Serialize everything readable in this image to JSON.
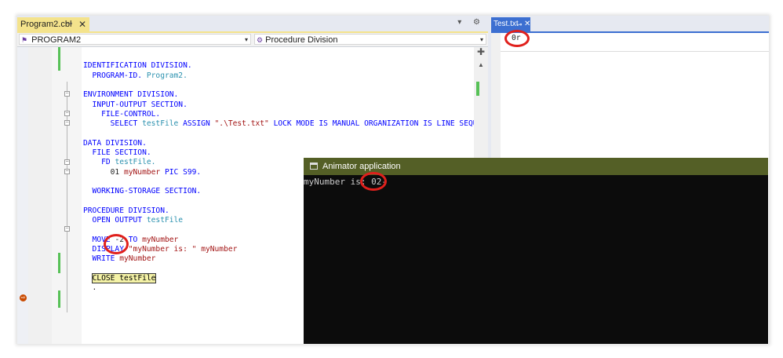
{
  "editor": {
    "tab_label": "Program2.cbl",
    "pin_glyph": "⊸",
    "close_glyph": "✕",
    "strip_icons": "▾ ⚙",
    "nav_left": "PROGRAM2",
    "nav_right": "Procedure Division",
    "dropdown_glyph": "▾",
    "breakpoint_glyph": "⇨"
  },
  "code_lines": [
    [],
    [
      {
        "t": "IDENTIFICATION DIVISION.",
        "c": "kw"
      }
    ],
    [
      {
        "t": "  PROGRAM-ID. ",
        "c": "kw"
      },
      {
        "t": "Program2.",
        "c": "id"
      }
    ],
    [],
    [
      {
        "t": "ENVIRONMENT DIVISION.",
        "c": "kw"
      }
    ],
    [
      {
        "t": "  INPUT-OUTPUT SECTION.",
        "c": "kw"
      }
    ],
    [
      {
        "t": "    FILE-CONTROL.",
        "c": "kw"
      }
    ],
    [
      {
        "t": "      SELECT ",
        "c": "kw"
      },
      {
        "t": "testFile ",
        "c": "id"
      },
      {
        "t": "ASSIGN ",
        "c": "kw"
      },
      {
        "t": "\".\\Test.txt\" ",
        "c": "str"
      },
      {
        "t": "LOCK MODE IS MANUAL ORGANIZATION IS LINE SEQUENTIA",
        "c": "kw"
      }
    ],
    [],
    [
      {
        "t": "DATA DIVISION.",
        "c": "kw"
      }
    ],
    [
      {
        "t": "  FILE SECTION.",
        "c": "kw"
      }
    ],
    [
      {
        "t": "    FD ",
        "c": "kw"
      },
      {
        "t": "testFile.",
        "c": "id"
      }
    ],
    [
      {
        "t": "      01 ",
        "c": "num"
      },
      {
        "t": "myNumber ",
        "c": "red"
      },
      {
        "t": "PIC S99.",
        "c": "kw"
      }
    ],
    [],
    [
      {
        "t": "  WORKING-STORAGE SECTION.",
        "c": "kw"
      }
    ],
    [],
    [
      {
        "t": "PROCEDURE DIVISION.",
        "c": "kw"
      }
    ],
    [
      {
        "t": "  OPEN OUTPUT ",
        "c": "kw"
      },
      {
        "t": "testFile",
        "c": "id"
      }
    ],
    [],
    [
      {
        "t": "  MOVE ",
        "c": "kw"
      },
      {
        "t": "-2",
        "c": "num"
      },
      {
        "t": " TO ",
        "c": "kw"
      },
      {
        "t": "myNumber",
        "c": "red"
      }
    ],
    [
      {
        "t": "  DISPLAY ",
        "c": "kw"
      },
      {
        "t": "\"myNumber is: \" ",
        "c": "str"
      },
      {
        "t": "myNumber",
        "c": "red"
      }
    ],
    [
      {
        "t": "  WRITE ",
        "c": "kw"
      },
      {
        "t": "myNumber",
        "c": "red"
      }
    ],
    [],
    [
      {
        "t": "  ",
        "c": ""
      },
      {
        "t": "CLOSE testFile",
        "c": "hl"
      }
    ],
    [
      {
        "t": "  .",
        "c": "num"
      }
    ]
  ],
  "right_pane": {
    "tab_label": "Test.txt",
    "pin_glyph": "⊸",
    "close_glyph": "✕",
    "content": "0r"
  },
  "console": {
    "title": "Animator application",
    "output": "myNumber is: 02-"
  },
  "colors": {
    "editor_tab": "#f4e38c",
    "right_tab": "#3c6fd1",
    "console_titlebar": "#545f26",
    "console_bg": "#0c0c0c",
    "annotation_circle": "#e0201c",
    "change_marker": "#57c157"
  }
}
